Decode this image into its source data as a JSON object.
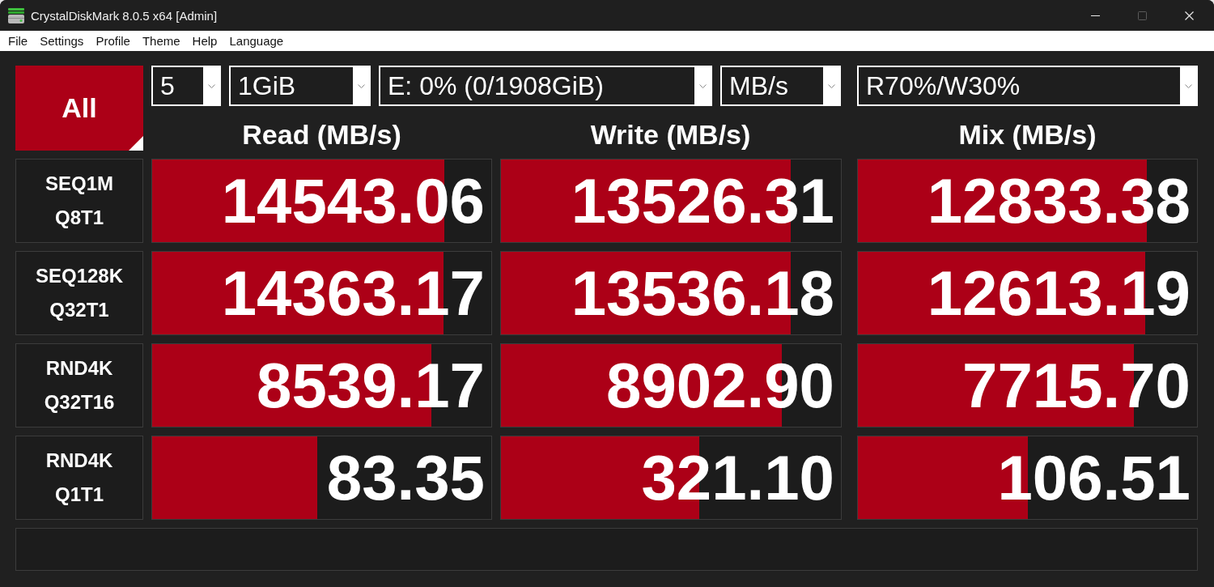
{
  "window": {
    "title": "CrystalDiskMark 8.0.5 x64 [Admin]",
    "controls": [
      {
        "kind": "minimize",
        "disabled": false
      },
      {
        "kind": "maximize",
        "disabled": true
      },
      {
        "kind": "close",
        "disabled": false
      }
    ]
  },
  "menu": [
    "File",
    "Settings",
    "Profile",
    "Theme",
    "Help",
    "Language"
  ],
  "all_button": {
    "label": "All"
  },
  "options": [
    {
      "kind": "count",
      "value": "5"
    },
    {
      "kind": "size",
      "value": "1GiB"
    },
    {
      "kind": "drive",
      "value": "E: 0% (0/1908GiB)"
    },
    {
      "kind": "unit",
      "value": "MB/s"
    },
    {
      "kind": "mix",
      "value": "R70%/W30%"
    }
  ],
  "columns": [
    "Read (MB/s)",
    "Write (MB/s)",
    "Mix (MB/s)"
  ],
  "tests": [
    {
      "name": "SEQ1M",
      "params": "Q8T1",
      "results": [
        {
          "value": "14543.06",
          "level": 0.862
        },
        {
          "value": "13526.31",
          "level": 0.853
        },
        {
          "value": "12833.38",
          "level": 0.853
        }
      ]
    },
    {
      "name": "SEQ128K",
      "params": "Q32T1",
      "results": [
        {
          "value": "14363.17",
          "level": 0.86
        },
        {
          "value": "13536.18",
          "level": 0.853
        },
        {
          "value": "12613.19",
          "level": 0.848
        }
      ]
    },
    {
      "name": "RND4K",
      "params": "Q32T16",
      "results": [
        {
          "value": "8539.17",
          "level": 0.824
        },
        {
          "value": "8902.90",
          "level": 0.825
        },
        {
          "value": "7715.70",
          "level": 0.815
        }
      ]
    },
    {
      "name": "RND4K",
      "params": "Q1T1",
      "results": [
        {
          "value": "83.35",
          "level": 0.487
        },
        {
          "value": "321.10",
          "level": 0.583
        },
        {
          "value": "106.51",
          "level": 0.501
        }
      ]
    }
  ]
}
